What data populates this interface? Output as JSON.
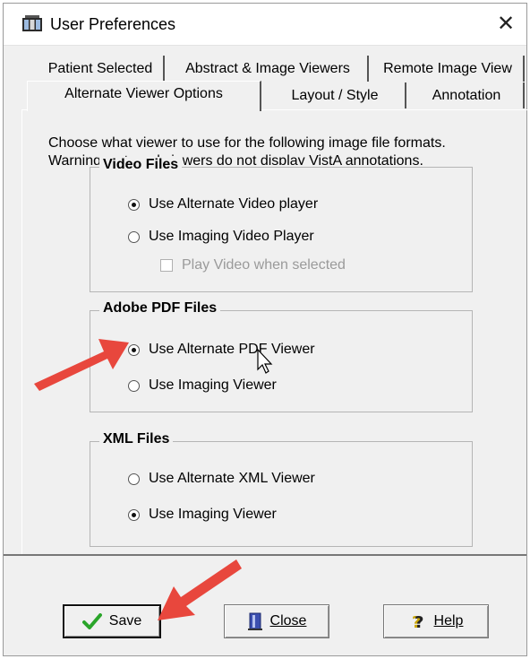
{
  "window": {
    "title": "User Preferences",
    "close_glyph": "✕"
  },
  "tabs": {
    "row1": [
      "Patient Selected",
      "Abstract & Image Viewers",
      "Remote Image View"
    ],
    "row2": [
      "Alternate Viewer Options",
      "Layout / Style",
      "Annotation"
    ],
    "active": "Alternate Viewer Options"
  },
  "instructions": {
    "line1": "Choose what viewer to use for the following image file formats.",
    "line2": "Warning: external viewers do not display VistA annotations."
  },
  "video_group": {
    "legend": "Video Files",
    "options": [
      {
        "label": "Use Alternate Video player",
        "checked": true
      },
      {
        "label": "Use Imaging Video Player",
        "checked": false
      }
    ],
    "checkbox": {
      "label": "Play Video when selected",
      "checked": false,
      "enabled": false
    }
  },
  "pdf_group": {
    "legend": "Adobe PDF Files",
    "options": [
      {
        "label": "Use Alternate PDF Viewer",
        "checked": true
      },
      {
        "label": "Use Imaging Viewer",
        "checked": false
      }
    ]
  },
  "xml_group": {
    "legend": "XML Files",
    "options": [
      {
        "label": "Use Alternate XML Viewer",
        "checked": false
      },
      {
        "label": "Use Imaging Viewer",
        "checked": true
      }
    ]
  },
  "buttons": {
    "save": "Save",
    "close": "Close",
    "help": "Help"
  },
  "icons": {
    "app": "app-icon",
    "save": "checkmark-icon",
    "close": "door-exit-icon",
    "help": "question-icon",
    "annotation_arrow": "red-arrow",
    "accent_red": "#e8473d",
    "check_green": "#2aa52a"
  }
}
